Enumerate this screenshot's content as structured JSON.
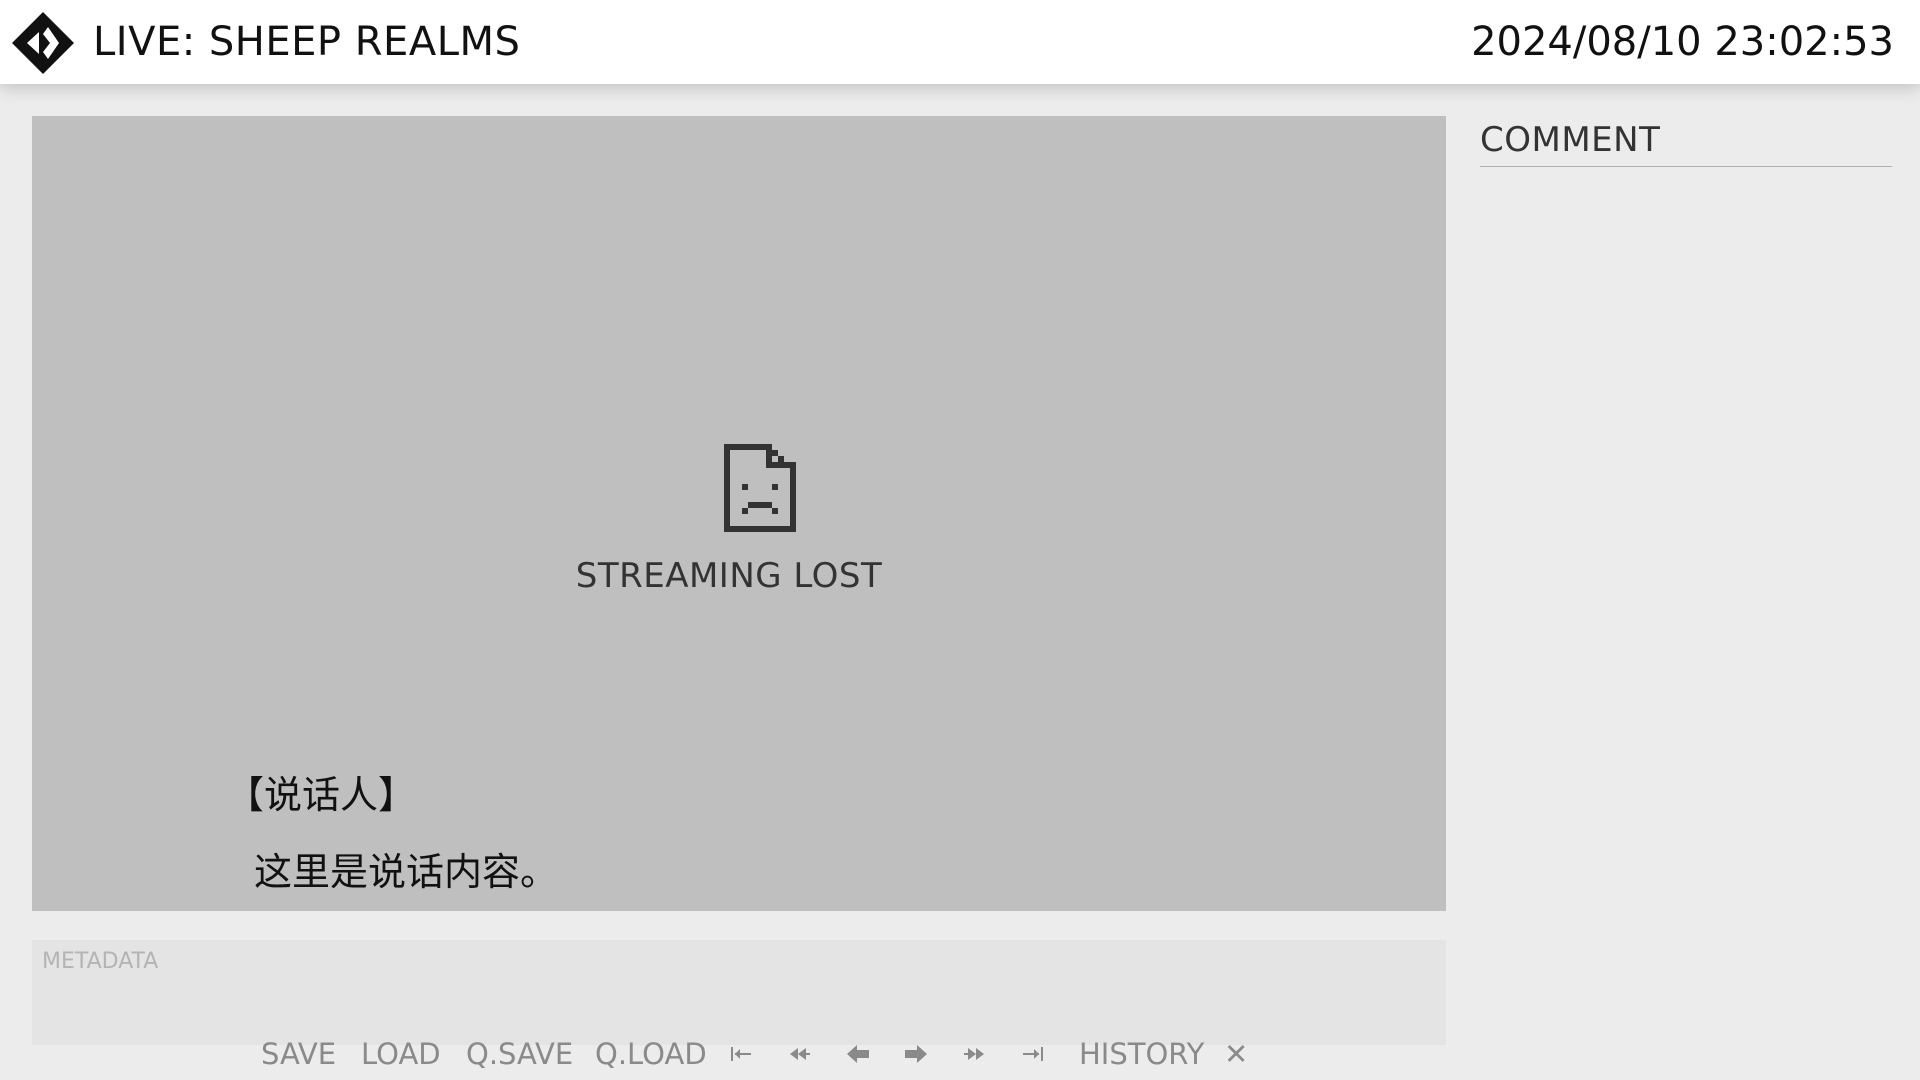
{
  "header": {
    "title": "LIVE: SHEEP REALMS",
    "datetime": "2024/08/10 23:02:53",
    "logo_icon": "diamond-logo-icon"
  },
  "stage": {
    "status_icon": "broken-file-icon",
    "status_text": "STREAMING LOST",
    "speaker": "【说话人】",
    "dialogue": "这里是说话内容。"
  },
  "metadata": {
    "label": "METADATA"
  },
  "controls": {
    "save": "SAVE",
    "load": "LOAD",
    "qsave": "Q.SAVE",
    "qload": "Q.LOAD",
    "history": "HISTORY",
    "close": "✕",
    "icons": [
      "skip-to-start-icon",
      "fast-rewind-icon",
      "back-arrow-icon",
      "forward-arrow-icon",
      "fast-forward-icon",
      "skip-to-end-icon"
    ]
  },
  "comments": {
    "title": "COMMENT"
  }
}
